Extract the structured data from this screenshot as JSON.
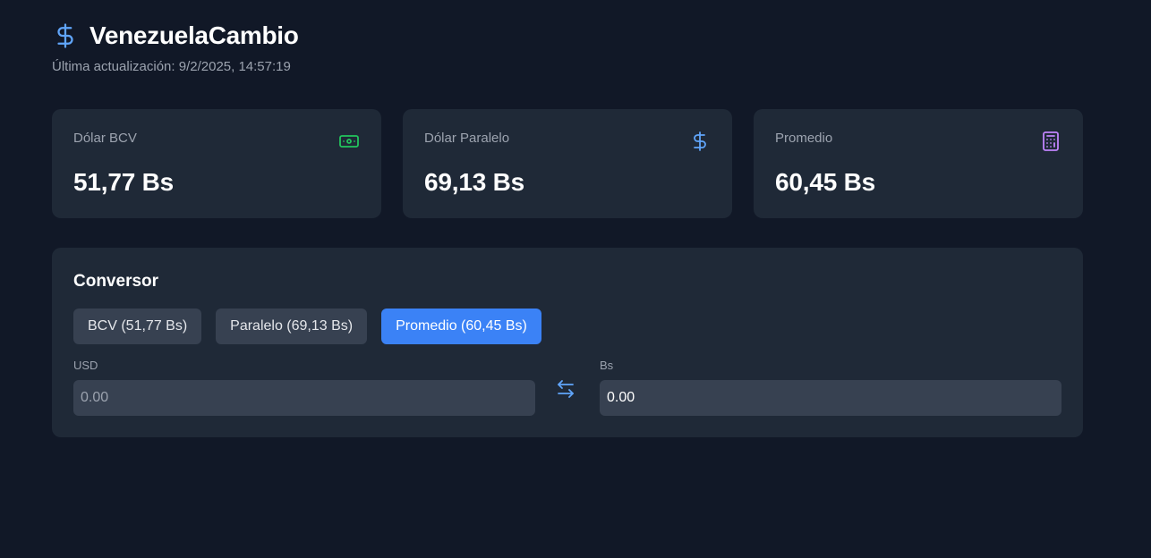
{
  "app": {
    "title": "VenezuelaCambio",
    "icon": "dollar-sign-icon",
    "last_updated_label": "Última actualización:",
    "last_updated_value": "9/2/2025, 14:57:19"
  },
  "cards": [
    {
      "label": "Dólar BCV",
      "value": "51,77 Bs",
      "icon": "banknote-icon",
      "icon_color": "#22c55e"
    },
    {
      "label": "Dólar Paralelo",
      "value": "69,13 Bs",
      "icon": "dollar-sign-icon",
      "icon_color": "#60a5fa"
    },
    {
      "label": "Promedio",
      "value": "60,45 Bs",
      "icon": "calculator-icon",
      "icon_color": "#c084fc"
    }
  ],
  "converter": {
    "title": "Conversor",
    "rates": [
      {
        "label": "BCV (51,77 Bs)",
        "active": false
      },
      {
        "label": "Paralelo (69,13 Bs)",
        "active": false
      },
      {
        "label": "Promedio (60,45 Bs)",
        "active": true
      }
    ],
    "usd": {
      "label": "USD",
      "value": "",
      "placeholder": "0.00"
    },
    "bs": {
      "label": "Bs",
      "value": "0.00",
      "placeholder": "0.00"
    },
    "swap_icon": "arrow-left-right-icon"
  },
  "colors": {
    "background": "#111827",
    "card": "#1f2937",
    "accent": "#3b82f6",
    "muted_text": "#9ca3af"
  }
}
